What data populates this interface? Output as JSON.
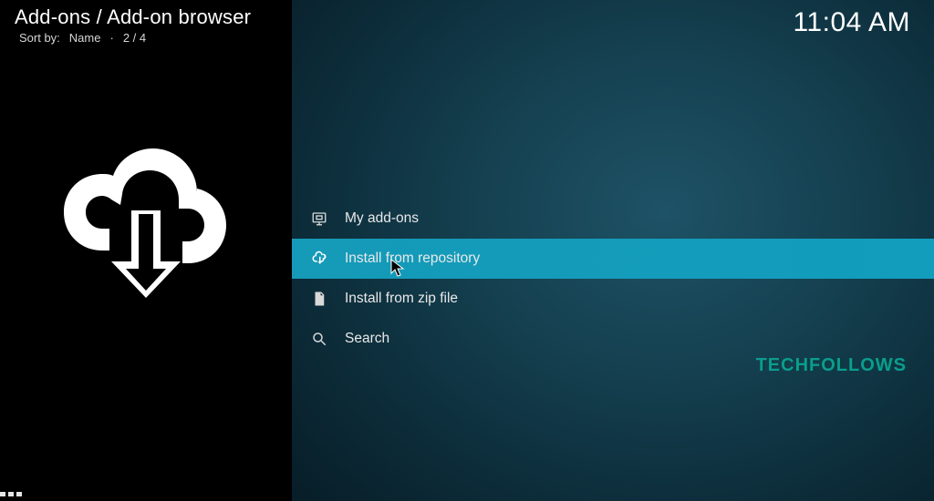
{
  "header": {
    "breadcrumb": "Add-ons / Add-on browser",
    "sort_prefix": "Sort by:",
    "sort_value": "Name",
    "counter": "2 / 4",
    "clock": "11:04 AM"
  },
  "menu": {
    "items": [
      {
        "label": "My add-ons",
        "icon": "monitor-box-icon",
        "selected": false
      },
      {
        "label": "Install from repository",
        "icon": "cloud-download-icon",
        "selected": true
      },
      {
        "label": "Install from zip file",
        "icon": "zip-file-icon",
        "selected": false
      },
      {
        "label": "Search",
        "icon": "search-icon",
        "selected": false
      }
    ]
  },
  "watermark": "TECHFOLLOWS"
}
